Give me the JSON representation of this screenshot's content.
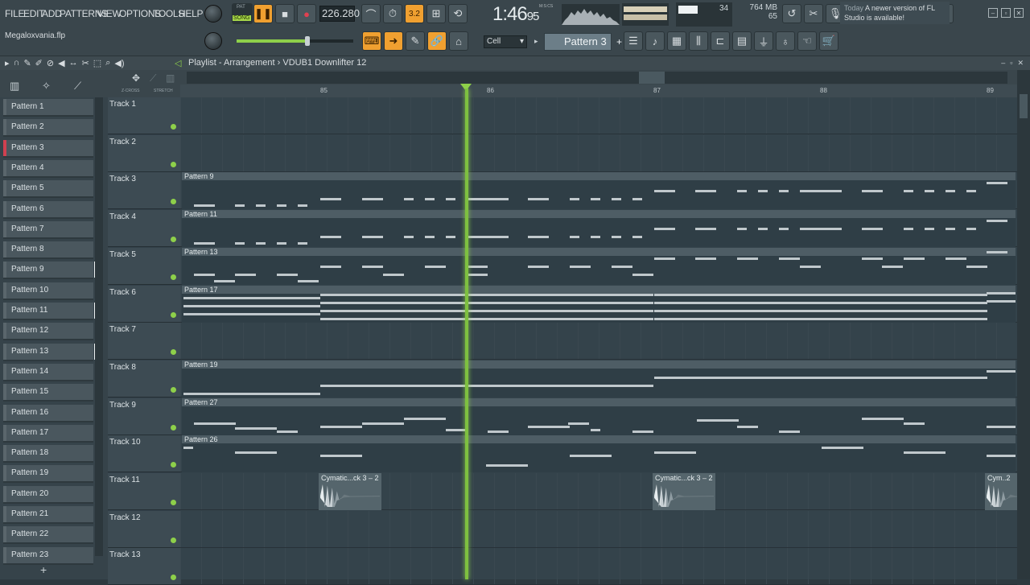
{
  "menu": [
    "FILE",
    "EDIT",
    "ADD",
    "PATTERNS",
    "VIEW",
    "OPTIONS",
    "TOOLS",
    "HELP"
  ],
  "transport": {
    "pat_label": "PAT",
    "song_label": "SONG",
    "tempo": "226.280",
    "clock": "1:46",
    "clock_small": "95",
    "mcs": "M:S:CS"
  },
  "project": {
    "filename": "Megaloxvania.flp"
  },
  "status": {
    "cpu": "34",
    "mem": "764 MB",
    "poly": "65"
  },
  "snap": {
    "value": "Cell"
  },
  "pattern_selector": {
    "value": "Pattern 3"
  },
  "news": {
    "today": "Today",
    "text": "A newer version of FL Studio is available!"
  },
  "playlist": {
    "title": "Playlist - Arrangement",
    "breadcrumb": "VDUB1 Downlifter 12",
    "xcross": "Z-CROSS",
    "stretch": "STRETCH"
  },
  "patterns": [
    "Pattern 1",
    "Pattern 2",
    "Pattern 3",
    "Pattern 4",
    "Pattern 5",
    "Pattern 6",
    "Pattern 7",
    "Pattern 8",
    "Pattern 9",
    "Pattern 10",
    "Pattern 11",
    "Pattern 12",
    "Pattern 13",
    "Pattern 14",
    "Pattern 15",
    "Pattern 16",
    "Pattern 17",
    "Pattern 18",
    "Pattern 19",
    "Pattern 20",
    "Pattern 21",
    "Pattern 22",
    "Pattern 23"
  ],
  "tracks": [
    "Track 1",
    "Track 2",
    "Track 3",
    "Track 4",
    "Track 5",
    "Track 6",
    "Track 7",
    "Track 8",
    "Track 9",
    "Track 10",
    "Track 11",
    "Track 12",
    "Track 13"
  ],
  "bars": [
    "85",
    "86",
    "87",
    "88",
    "89"
  ],
  "clips": {
    "t3": "Pattern 9",
    "t4": "Pattern 11",
    "t5": "Pattern 13",
    "t6": "Pattern 17",
    "t8": "Pattern 19",
    "t9": "Pattern 27",
    "t10": "Pattern 26",
    "audio1": "Cymatic...ck 3 – 2",
    "audio2": "Cymatic...ck 3 – 2",
    "audio3": "Cym..2"
  },
  "colors": {
    "accent": "#f0a030",
    "playhead": "#8ed04a",
    "selected_pattern": "#d04050"
  }
}
